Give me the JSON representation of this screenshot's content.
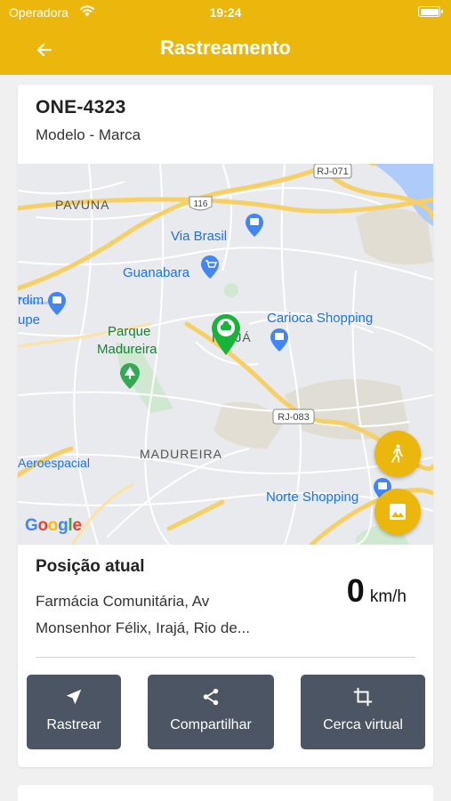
{
  "status_bar": {
    "carrier": "Operadora",
    "time": "19:24"
  },
  "header": {
    "title": "Rastreamento"
  },
  "vehicle": {
    "plate": "ONE-4323",
    "model": "Modelo - Marca"
  },
  "map": {
    "labels": {
      "pavuna": "PAVUNA",
      "via_brasil": "Via Brasil",
      "guanabara": "Guanabara",
      "parque_madureira_1": "Parque",
      "parque_madureira_2": "Madureira",
      "carioca_shopping": "Carioca Shopping",
      "iraja": "IRAJÁ",
      "madureira": "MADUREIRA",
      "aeroespacial": "Aeroespacial",
      "norte_shopping": "Norte Shopping",
      "jardim_1": "rdim",
      "jardim_2": "upe",
      "road_rj071": "RJ-071",
      "road_116": "116",
      "road_rj083": "RJ-083"
    },
    "attribution": "Google"
  },
  "position": {
    "title": "Posição atual",
    "address_line1": "Farmácia Comunitária, Av",
    "address_line2": "Monsenhor Félix, Irajá, Rio de...",
    "speed_value": "0",
    "speed_unit": "km/h"
  },
  "actions": [
    {
      "label": "Rastrear",
      "icon": "navigation-arrow-icon"
    },
    {
      "label": "Compartilhar",
      "icon": "share-icon"
    },
    {
      "label": "Cerca virtual",
      "icon": "crop-icon"
    }
  ],
  "colors": {
    "accent": "#ebb70c",
    "button_bg": "#4b5563",
    "marker": "#18b43a"
  }
}
